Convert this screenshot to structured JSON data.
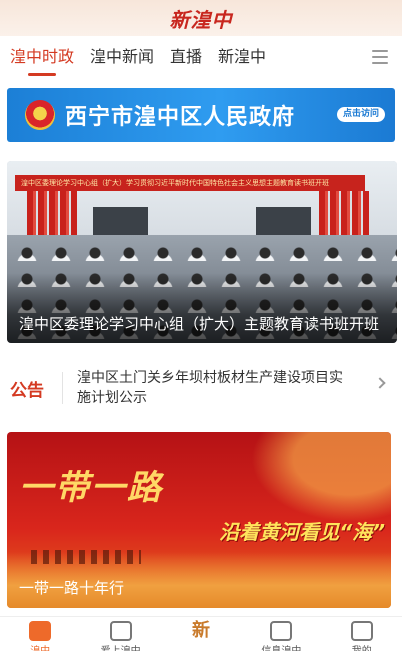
{
  "app": {
    "logo_text": "新湟中"
  },
  "tabs": [
    {
      "label": "湟中时政",
      "active": true
    },
    {
      "label": "湟中新闻",
      "active": false
    },
    {
      "label": "直播",
      "active": false
    },
    {
      "label": "新湟中",
      "active": false
    }
  ],
  "gov_banner": {
    "title": "西宁市湟中区人民政府",
    "visit_label": "点击访问"
  },
  "news": {
    "banner_text": "湟中区委理论学习中心组（扩大）学习贯彻习近平新时代中国特色社会主义思想主题教育读书班开班",
    "title": "湟中区委理论学习中心组（扩大）主题教育读书班开班"
  },
  "notice": {
    "label": "公告",
    "text": "湟中区土门关乡年坝村板材生产建设项目实施计划公示"
  },
  "promo": {
    "calligraphy": "一带一路",
    "slogan": "沿着黄河看见“海”",
    "caption": "一带一路十年行"
  },
  "bottom_nav": [
    {
      "label": "湟中",
      "active": true
    },
    {
      "label": "爱上湟中",
      "active": false
    },
    {
      "label": "新",
      "active": false
    },
    {
      "label": "信息湟中",
      "active": false
    },
    {
      "label": "我的",
      "active": false
    }
  ],
  "colors": {
    "accent": "#d43a22",
    "gov_blue": "#1c7fd6",
    "nav_active": "#ee6a2a"
  }
}
